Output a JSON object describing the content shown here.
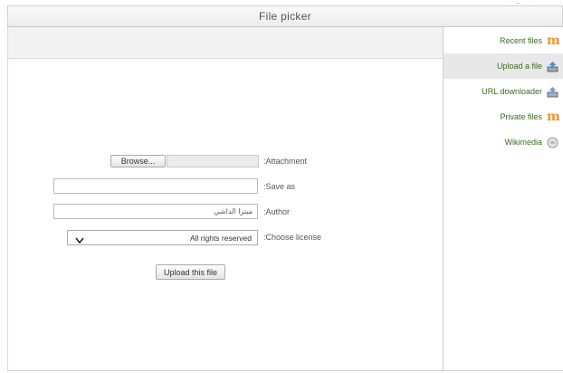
{
  "window": {
    "title": "File picker"
  },
  "repositories": [
    {
      "label": "Recent files",
      "icon": "moodle-icon",
      "active": false
    },
    {
      "label": "Upload a file",
      "icon": "upload-icon",
      "active": true
    },
    {
      "label": "URL downloader",
      "icon": "url-icon",
      "active": false
    },
    {
      "label": "Private files",
      "icon": "moodle-icon",
      "active": false
    },
    {
      "label": "Wikimedia",
      "icon": "wikimedia-icon",
      "active": false
    }
  ],
  "form": {
    "attachment_label": ":Attachment",
    "browse_label": "Browse...",
    "saveas_label": ":Save as",
    "saveas_value": "",
    "author_label": ":Author",
    "author_value": "ميترا الداشي",
    "license_label": ":Choose license",
    "license_value": "All rights reserved",
    "upload_button": "Upload this file"
  },
  "colors": {
    "repo_text": "#3a6b1f",
    "moodle_orange": "#f7931e",
    "active_bg": "#e8e8e8"
  }
}
